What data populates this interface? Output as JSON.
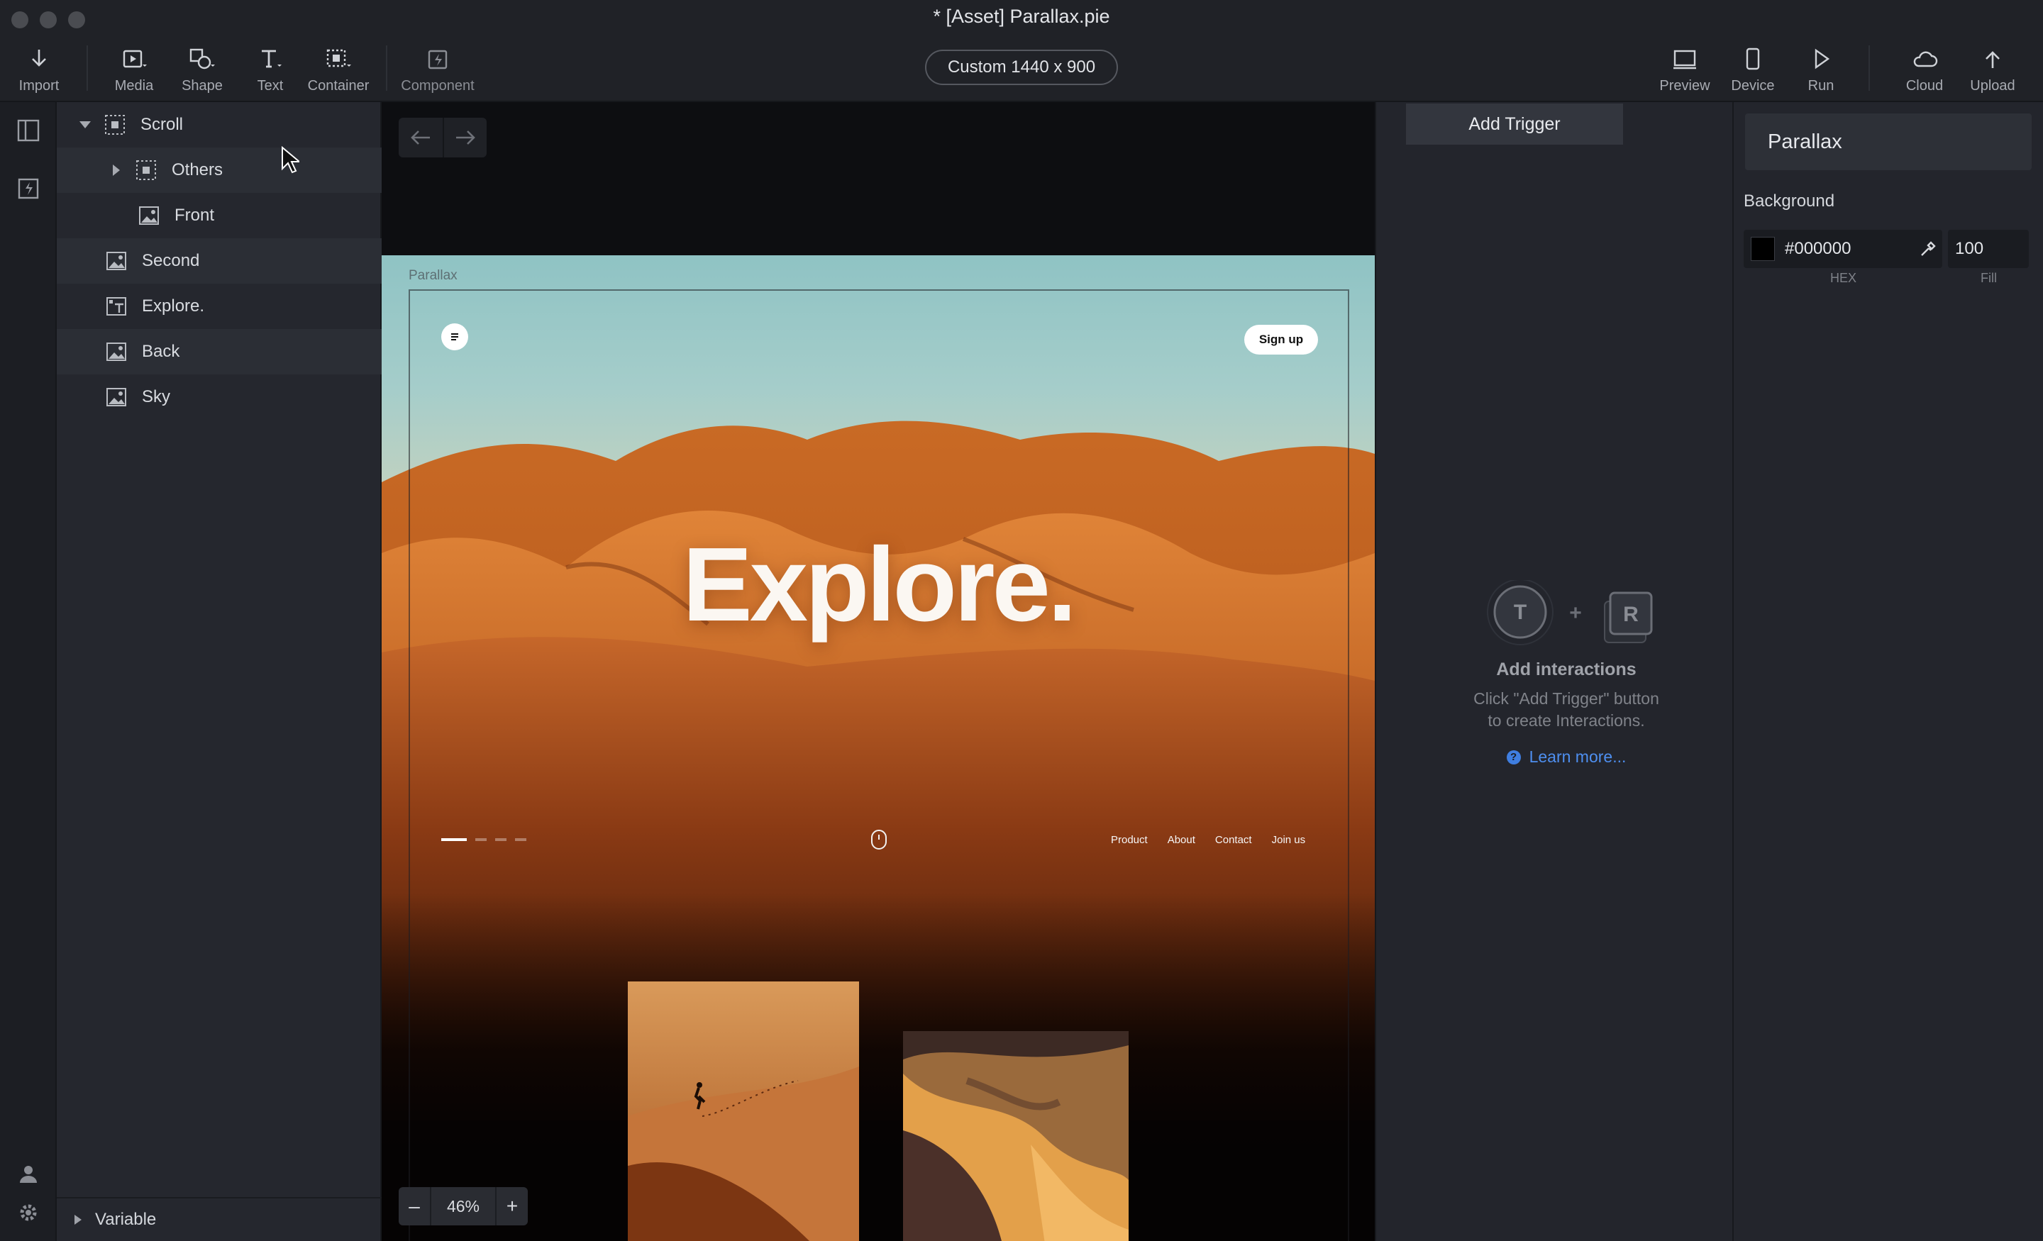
{
  "window": {
    "title": "* [Asset] Parallax.pie"
  },
  "toolbar": {
    "import": "Import",
    "media": "Media",
    "shape": "Shape",
    "text": "Text",
    "container": "Container",
    "component": "Component",
    "canvas_size": "Custom  1440 x 900",
    "preview": "Preview",
    "device": "Device",
    "run": "Run",
    "cloud": "Cloud",
    "upload": "Upload"
  },
  "layers": [
    {
      "label": "Scroll",
      "icon": "container-icon"
    },
    {
      "label": "Others",
      "icon": "container-icon"
    },
    {
      "label": "Front",
      "icon": "image-icon"
    },
    {
      "label": "Second",
      "icon": "image-icon"
    },
    {
      "label": "Explore.",
      "icon": "text-layer-icon"
    },
    {
      "label": "Back",
      "icon": "image-icon"
    },
    {
      "label": "Sky",
      "icon": "image-icon"
    }
  ],
  "variable_section": "Variable",
  "artboard": {
    "label": "Parallax",
    "signup": "Sign up",
    "headline": "Explore.",
    "nav": [
      "Product",
      "About",
      "Contact",
      "Join us"
    ]
  },
  "zoom": {
    "minus": "–",
    "value": "46%",
    "plus": "+"
  },
  "interactions": {
    "add_trigger": "Add Trigger",
    "trigger_letter": "T",
    "plus": "+",
    "response_letter": "R",
    "title": "Add interactions",
    "desc_line1": "Click \"Add Trigger\" button",
    "desc_line2": "to create Interactions.",
    "help_mark": "?",
    "learn_more": "Learn more..."
  },
  "properties": {
    "name": "Parallax",
    "background_label": "Background",
    "hex_value": "#000000",
    "fill_value": "100",
    "hex_caption": "HEX",
    "fill_caption": "Fill",
    "swatch_color": "#000000"
  },
  "colors": {
    "accent_link": "#4e8ff0",
    "panel_bg": "#23252c",
    "canvas_bg": "#0d0e11"
  }
}
